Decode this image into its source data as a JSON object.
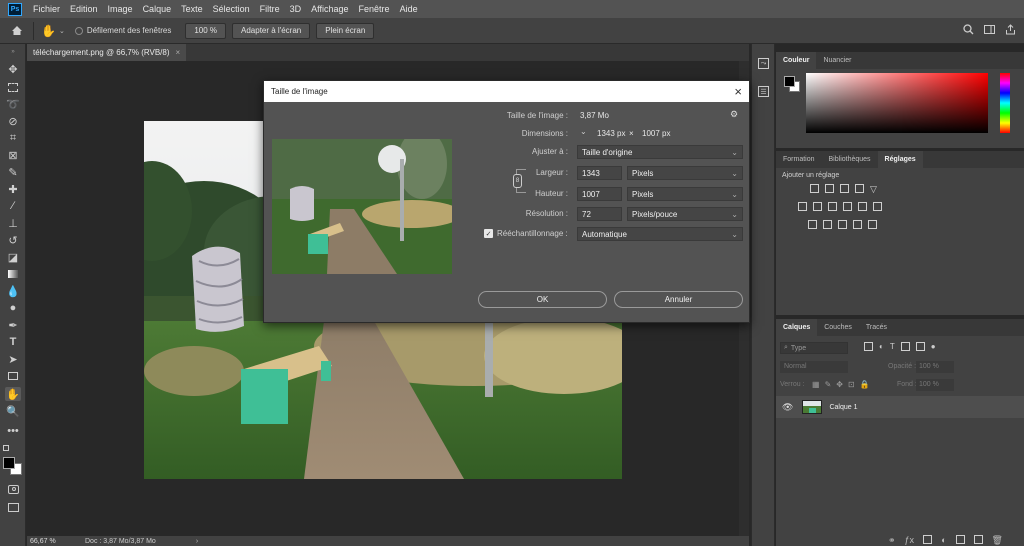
{
  "menubar": {
    "app_logo": "Ps",
    "items": [
      "Fichier",
      "Edition",
      "Image",
      "Calque",
      "Texte",
      "Sélection",
      "Filtre",
      "3D",
      "Affichage",
      "Fenêtre",
      "Aide"
    ]
  },
  "options_bar": {
    "scroll_all_windows_label": "Défilement des fenêtres",
    "zoom_value": "100 %",
    "fit_screen_label": "Adapter à l'écran",
    "fill_screen_label": "Plein écran"
  },
  "document": {
    "tab_title": "téléchargement.png @ 66,7% (RVB/8)",
    "close": "×"
  },
  "statusbar": {
    "zoom": "66,67 %",
    "doc_info": "Doc : 3,87 Mo/3,87 Mo",
    "arrow": "›"
  },
  "color_panel": {
    "tabs": [
      "Couleur",
      "Nuancier"
    ]
  },
  "adjust_panel": {
    "tabs": [
      "Formation",
      "Bibliothèques",
      "Réglages"
    ],
    "add_label": "Ajouter un réglage"
  },
  "layers_panel": {
    "tabs": [
      "Calques",
      "Couches",
      "Tracés"
    ],
    "filter_placeholder": "Type",
    "blend_mode": "Normal",
    "opacity_label": "Opacité :",
    "opacity_value": "100 %",
    "lock_label": "Verrou :",
    "fill_label": "Fond :",
    "fill_value": "100 %",
    "layer_name": "Calque 1"
  },
  "dialog": {
    "title": "Taille de l'image",
    "close": "×",
    "image_size_label": "Taille de l'image :",
    "image_size_value": "3,87 Mo",
    "dimensions_label": "Dimensions :",
    "dimensions_w": "1343 px",
    "dimensions_x": "×",
    "dimensions_h": "1007 px",
    "fit_label": "Ajuster à :",
    "fit_value": "Taille d'origine",
    "width_label": "Largeur :",
    "width_value": "1343",
    "width_unit": "Pixels",
    "height_label": "Hauteur :",
    "height_value": "1007",
    "height_unit": "Pixels",
    "resolution_label": "Résolution :",
    "resolution_value": "72",
    "resolution_unit": "Pixels/pouce",
    "resample_label": "Rééchantillonnage :",
    "resample_value": "Automatique",
    "ok_label": "OK",
    "cancel_label": "Annuler"
  },
  "colors": {
    "accent_blue": "#31a8ff",
    "bench_green": "#3fbf96"
  }
}
